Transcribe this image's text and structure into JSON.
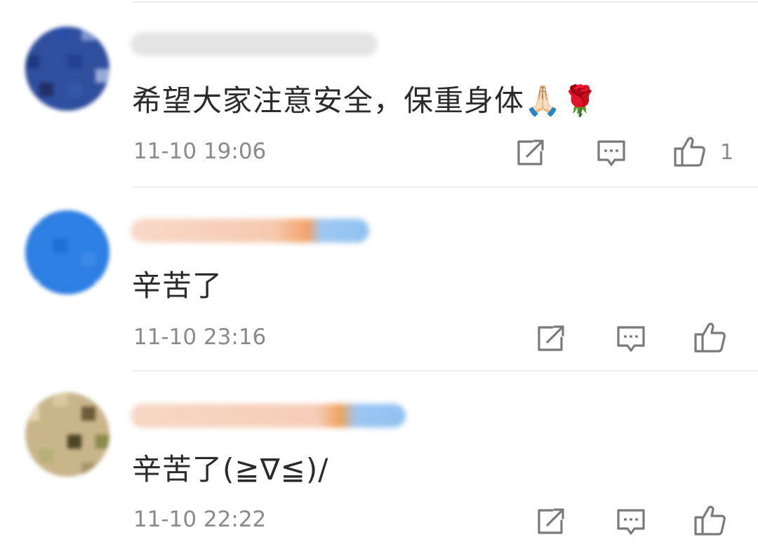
{
  "comments": [
    {
      "text": "希望大家注意安全，保重身体🙏🏻🌹",
      "time": "11-10 19:06",
      "like_count": "1",
      "icons": {
        "share": "share-icon",
        "reply": "reply-comment-icon",
        "like": "thumbs-up-icon"
      }
    },
    {
      "text": "辛苦了",
      "time": "11-10 23:16",
      "like_count": "",
      "icons": {
        "share": "share-icon",
        "reply": "reply-comment-icon",
        "like": "thumbs-up-icon"
      }
    },
    {
      "text": "辛苦了(≧∇≦)/",
      "time": "11-10 22:22",
      "like_count": "",
      "icons": {
        "share": "share-icon",
        "reply": "reply-comment-icon",
        "like": "thumbs-up-icon"
      }
    }
  ],
  "colors": {
    "text": "#2b2b2b",
    "meta": "#8a8a8a",
    "icon": "#7a7a7a",
    "divider": "#ededed"
  }
}
